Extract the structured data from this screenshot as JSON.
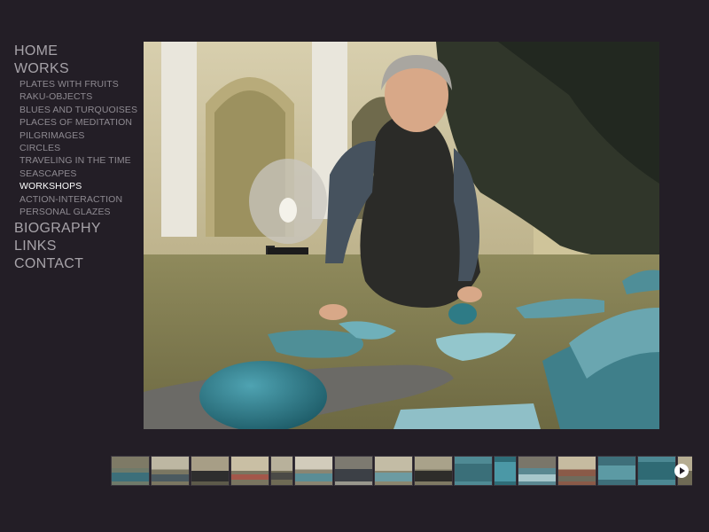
{
  "nav": {
    "home": "HOME",
    "works": "WORKS",
    "works_items": [
      "PLATES WITH FRUITS",
      "RAKU-OBJECTS",
      "BLUES AND TURQUOISES",
      "PLACES OF MEDITATION",
      "PILGRIMAGES",
      "CIRCLES",
      "TRAVELING IN THE TIME",
      "SEASCAPES",
      "WORKSHOPS",
      "ACTION-INTERACTION",
      "PERSONAL GLAZES"
    ],
    "active_item": "WORKSHOPS",
    "biography": "BIOGRAPHY",
    "links": "LINKS",
    "contact": "CONTACT"
  },
  "colors": {
    "background": "#231e26",
    "nav_text": "#a7a3a9",
    "active_text": "#ffffff"
  },
  "gallery": {
    "main_image": "woman-kneeling-with-turquoise-raku-ceramics-in-courtyard",
    "thumbnail_count": 15,
    "next_icon": "play-circle-icon"
  }
}
